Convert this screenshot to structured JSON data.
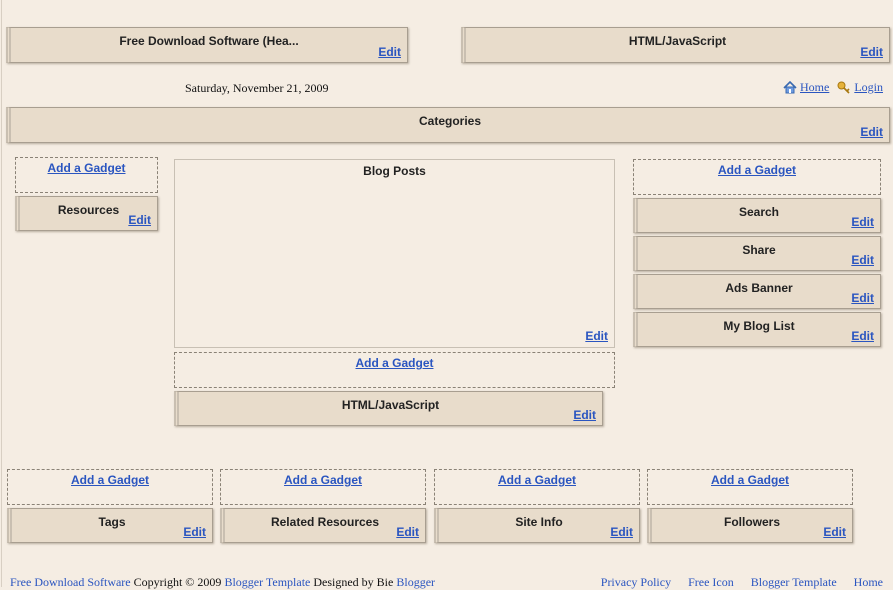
{
  "header": {
    "left_widget": {
      "title": "Free Download Software (Hea...",
      "edit": "Edit"
    },
    "right_widget": {
      "title": "HTML/JavaScript",
      "edit": "Edit"
    }
  },
  "date": "Saturday, November 21, 2009",
  "toplinks": {
    "home": "Home",
    "login": "Login"
  },
  "categories": {
    "title": "Categories",
    "edit": "Edit"
  },
  "add_gadget": "Add a Gadget",
  "left_sidebar": {
    "resources": {
      "title": "Resources",
      "edit": "Edit"
    }
  },
  "main": {
    "blog_posts": {
      "title": "Blog Posts",
      "edit": "Edit"
    },
    "html_js": {
      "title": "HTML/JavaScript",
      "edit": "Edit"
    }
  },
  "right_sidebar": {
    "widgets": [
      {
        "title": "Search",
        "edit": "Edit"
      },
      {
        "title": "Share",
        "edit": "Edit"
      },
      {
        "title": "Ads Banner",
        "edit": "Edit"
      },
      {
        "title": "My Blog List",
        "edit": "Edit"
      }
    ]
  },
  "bottom": {
    "widgets": [
      {
        "title": "Tags",
        "edit": "Edit"
      },
      {
        "title": "Related Resources",
        "edit": "Edit"
      },
      {
        "title": "Site Info",
        "edit": "Edit"
      },
      {
        "title": "Followers",
        "edit": "Edit"
      }
    ]
  },
  "footer": {
    "site_link": "Free Download Software",
    "copyright": " Copyright © 2009 ",
    "template_link": "Blogger Template",
    "designed_by": " Designed by Bie ",
    "blogger_link": "Blogger",
    "right_links": [
      "Privacy Policy",
      "Free Icon",
      "Blogger Template",
      "Home"
    ]
  }
}
